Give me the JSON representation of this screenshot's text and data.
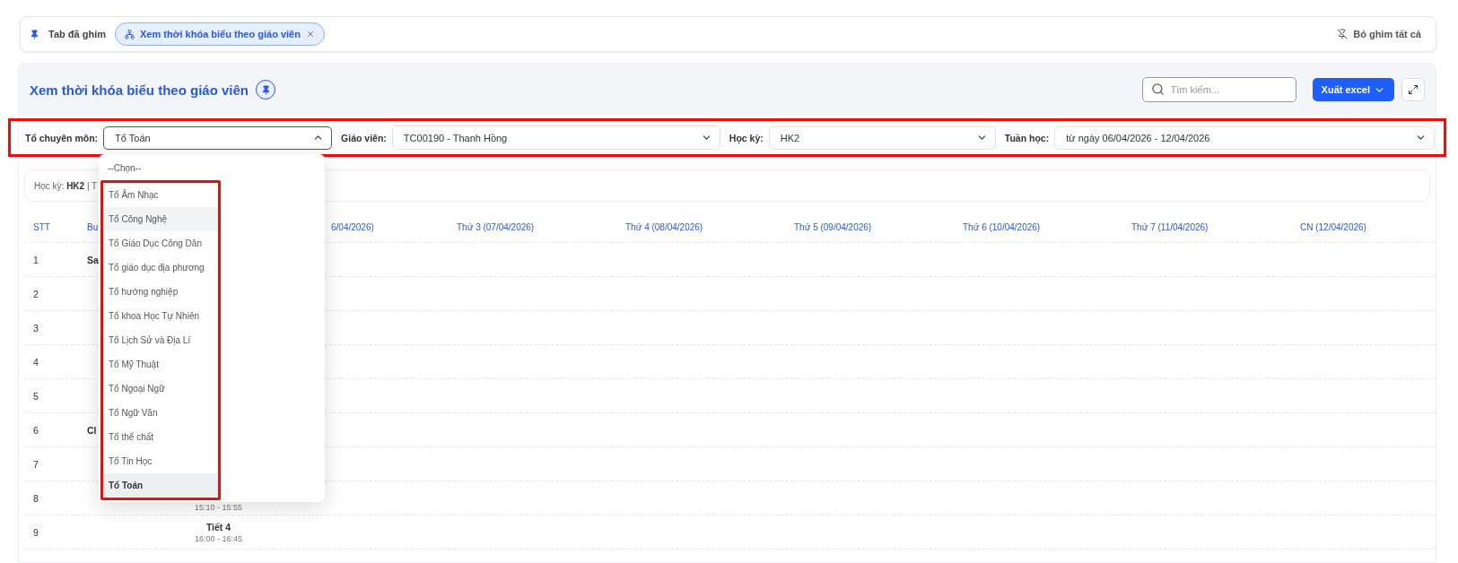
{
  "pinned_bar": {
    "label": "Tab đã ghim",
    "tabs": [
      {
        "label": "Xem thời khóa biểu theo giáo viên",
        "selected": true
      }
    ],
    "unpin_all": "Bỏ ghim tất cả"
  },
  "page": {
    "title": "Xem thời khóa biểu theo giáo viên",
    "search": {
      "placeholder": "Tìm kiếm..."
    },
    "export_button": "Xuất excel"
  },
  "filters": {
    "highlighted": true,
    "fields": [
      {
        "label": "Tổ chuyên môn:",
        "value": "Tổ Toán",
        "expanded": true
      },
      {
        "label": "Giáo viên:",
        "value": "TC00190 - Thanh Hồng",
        "expanded": false
      },
      {
        "label": "Học kỳ:",
        "value": "HK2",
        "expanded": false
      },
      {
        "label": "Tuần học:",
        "value": "từ ngày 06/04/2026 - 12/04/2026",
        "expanded": false
      }
    ]
  },
  "dropdown": {
    "placeholder_option": "--Chọn--",
    "highlighted": true,
    "options": [
      {
        "label": "Tổ Âm Nhạc",
        "selected": false,
        "hovered": false
      },
      {
        "label": "Tổ Công Nghệ",
        "selected": false,
        "hovered": true
      },
      {
        "label": "Tổ Giáo Dục Công Dân",
        "selected": false,
        "hovered": false
      },
      {
        "label": "Tổ giáo dục địa phương",
        "selected": false,
        "hovered": false
      },
      {
        "label": "Tổ hướng nghiệp",
        "selected": false,
        "hovered": false
      },
      {
        "label": "Tổ khoa Học Tự Nhiên",
        "selected": false,
        "hovered": false
      },
      {
        "label": "Tổ Lịch Sử và Địa Lí",
        "selected": false,
        "hovered": false
      },
      {
        "label": "Tổ Mỹ Thuật",
        "selected": false,
        "hovered": false
      },
      {
        "label": "Tổ Ngoại Ngữ",
        "selected": false,
        "hovered": false
      },
      {
        "label": "Tổ Ngữ Văn",
        "selected": false,
        "hovered": false
      },
      {
        "label": "Tổ thể chất",
        "selected": false,
        "hovered": false
      },
      {
        "label": "Tổ Tin Học",
        "selected": false,
        "hovered": false
      },
      {
        "label": "Tổ Toán",
        "selected": true,
        "hovered": false
      }
    ]
  },
  "info": "Học kỳ: **HK2** | T",
  "table": {
    "columns": [
      "STT",
      "Bu",
      "6/04/2026)",
      "Thứ 3 (07/04/2026)",
      "Thứ 4 (08/04/2026)",
      "Thứ 5 (09/04/2026)",
      "Thứ 6 (10/04/2026)",
      "Thứ 7 (11/04/2026)",
      "CN (12/04/2026)"
    ],
    "rows": [
      {
        "stt": "1",
        "session": "Sa"
      },
      {
        "stt": "2"
      },
      {
        "stt": "3"
      },
      {
        "stt": "4"
      },
      {
        "stt": "5"
      },
      {
        "stt": "6",
        "session": "Cl"
      },
      {
        "stt": "7"
      },
      {
        "stt": "8",
        "time": "15:10 - 15:55"
      },
      {
        "stt": "9",
        "period": "Tiết 4",
        "time": "16:00 - 16:45"
      }
    ]
  }
}
